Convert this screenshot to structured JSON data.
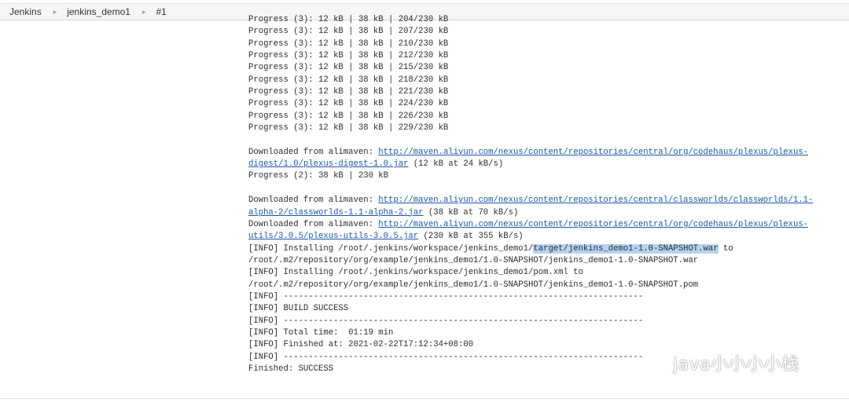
{
  "breadcrumb": [
    "Jenkins",
    "jenkins_demo1",
    "#1"
  ],
  "console": {
    "partial_top_line": "Progress (3): 12 kB | 38 kB | 204/230 kB",
    "lines": [
      {
        "text": "Progress (3): 12 kB | 38 kB | 207/230 kB"
      },
      {
        "text": "Progress (3): 12 kB | 38 kB | 210/230 kB"
      },
      {
        "text": "Progress (3): 12 kB | 38 kB | 212/230 kB"
      },
      {
        "text": "Progress (3): 12 kB | 38 kB | 215/230 kB"
      },
      {
        "text": "Progress (3): 12 kB | 38 kB | 218/230 kB"
      },
      {
        "text": "Progress (3): 12 kB | 38 kB | 221/230 kB"
      },
      {
        "text": "Progress (3): 12 kB | 38 kB | 224/230 kB"
      },
      {
        "text": "Progress (3): 12 kB | 38 kB | 226/230 kB"
      },
      {
        "text": "Progress (3): 12 kB | 38 kB | 229/230 kB"
      },
      {
        "text": ""
      },
      {
        "pre": "Downloaded from alimaven: ",
        "link": "http://maven.aliyun.com/nexus/content/repositories/central/org/codehaus/plexus/plexus-"
      },
      {
        "link": "digest/1.0/plexus-digest-1.0.jar",
        "post": " (12 kB at 24 kB/s)"
      },
      {
        "text": "Progress (2): 38 kB | 230 kB"
      },
      {
        "text": ""
      },
      {
        "pre": "Downloaded from alimaven: ",
        "link": "http://maven.aliyun.com/nexus/content/repositories/central/classworlds/classworlds/1.1-"
      },
      {
        "link": "alpha-2/classworlds-1.1-alpha-2.jar",
        "post": " (38 kB at 70 kB/s)"
      },
      {
        "pre": "Downloaded from alimaven: ",
        "link": "http://maven.aliyun.com/nexus/content/repositories/central/org/codehaus/plexus/plexus-"
      },
      {
        "link": "utils/3.0.5/plexus-utils-3.0.5.jar",
        "post": " (230 kB at 355 kB/s)"
      },
      {
        "pre": "[INFO] Installing /root/.jenkins/workspace/jenkins_demo1/",
        "highlight": "target/jenkins_demo1-1.0-SNAPSHOT.war",
        "post": " to"
      },
      {
        "text": "/root/.m2/repository/org/example/jenkins_demo1/1.0-SNAPSHOT/jenkins_demo1-1.0-SNAPSHOT.war"
      },
      {
        "text": "[INFO] Installing /root/.jenkins/workspace/jenkins_demo1/pom.xml to"
      },
      {
        "text": "/root/.m2/repository/org/example/jenkins_demo1/1.0-SNAPSHOT/jenkins_demo1-1.0-SNAPSHOT.pom"
      },
      {
        "text": "[INFO] ------------------------------------------------------------------------"
      },
      {
        "text": "[INFO] BUILD SUCCESS"
      },
      {
        "text": "[INFO] ------------------------------------------------------------------------"
      },
      {
        "text": "[INFO] Total time:  01:19 min"
      },
      {
        "text": "[INFO] Finished at: 2021-02-22T17:12:34+08:00"
      },
      {
        "text": "[INFO] ------------------------------------------------------------------------"
      },
      {
        "text": "Finished: SUCCESS"
      }
    ]
  },
  "watermark": {
    "text": "java小小小小栈",
    "icon": "wechat-icon"
  },
  "colors": {
    "link": "#1a56a8",
    "selection": "#b5d3f3",
    "breadcrumb_bg": "#f6f7f5"
  }
}
